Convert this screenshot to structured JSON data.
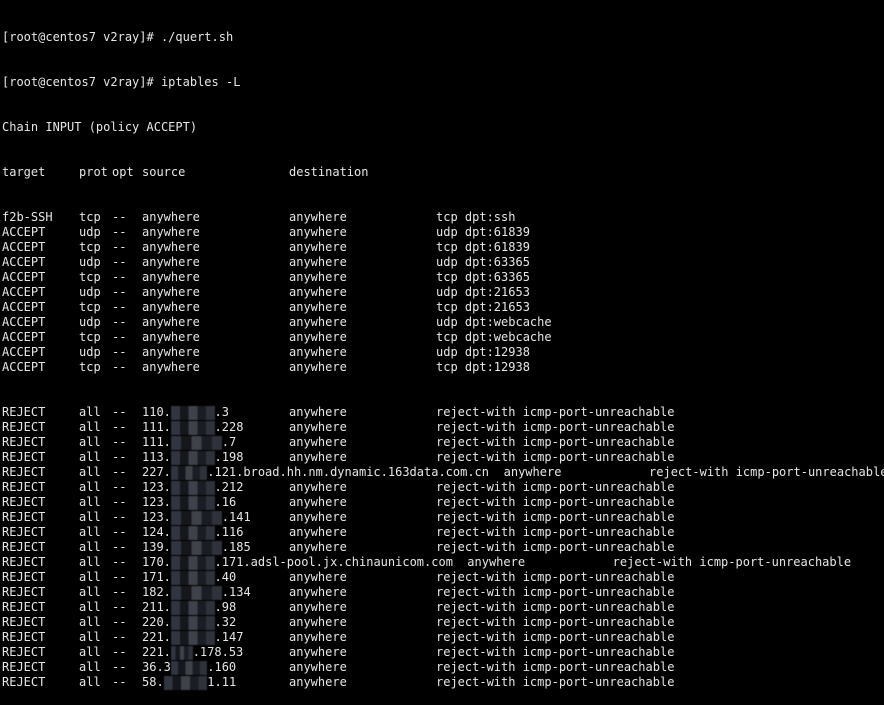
{
  "terminal": {
    "prompt_lines": [
      {
        "prompt": "[root@centos7 v2ray]# ",
        "command": "./quert.sh"
      },
      {
        "prompt": "[root@centos7 v2ray]# ",
        "command": "iptables -L"
      }
    ],
    "chain_header": "Chain INPUT (policy ACCEPT)",
    "columns": {
      "target": "target",
      "prot": "prot",
      "opt": "opt",
      "source": "source",
      "destination": "destination"
    },
    "accept_rules": [
      {
        "target": "f2b-SSH",
        "prot": "tcp",
        "opt": "--",
        "source": "anywhere",
        "destination": "anywhere",
        "extra": "tcp dpt:ssh"
      },
      {
        "target": "ACCEPT",
        "prot": "udp",
        "opt": "--",
        "source": "anywhere",
        "destination": "anywhere",
        "extra": "udp dpt:61839"
      },
      {
        "target": "ACCEPT",
        "prot": "tcp",
        "opt": "--",
        "source": "anywhere",
        "destination": "anywhere",
        "extra": "tcp dpt:61839"
      },
      {
        "target": "ACCEPT",
        "prot": "udp",
        "opt": "--",
        "source": "anywhere",
        "destination": "anywhere",
        "extra": "udp dpt:63365"
      },
      {
        "target": "ACCEPT",
        "prot": "tcp",
        "opt": "--",
        "source": "anywhere",
        "destination": "anywhere",
        "extra": "tcp dpt:63365"
      },
      {
        "target": "ACCEPT",
        "prot": "udp",
        "opt": "--",
        "source": "anywhere",
        "destination": "anywhere",
        "extra": "udp dpt:21653"
      },
      {
        "target": "ACCEPT",
        "prot": "tcp",
        "opt": "--",
        "source": "anywhere",
        "destination": "anywhere",
        "extra": "tcp dpt:21653"
      },
      {
        "target": "ACCEPT",
        "prot": "udp",
        "opt": "--",
        "source": "anywhere",
        "destination": "anywhere",
        "extra": "udp dpt:webcache"
      },
      {
        "target": "ACCEPT",
        "prot": "tcp",
        "opt": "--",
        "source": "anywhere",
        "destination": "anywhere",
        "extra": "tcp dpt:webcache"
      },
      {
        "target": "ACCEPT",
        "prot": "udp",
        "opt": "--",
        "source": "anywhere",
        "destination": "anywhere",
        "extra": "udp dpt:12938"
      },
      {
        "target": "ACCEPT",
        "prot": "tcp",
        "opt": "--",
        "source": "anywhere",
        "destination": "anywhere",
        "extra": "tcp dpt:12938"
      }
    ],
    "reject_rules": [
      {
        "target": "REJECT",
        "prot": "all",
        "opt": "--",
        "source_prefix": "110.",
        "source_suffix": ".3",
        "blur_chars": 6,
        "destination": "anywhere",
        "extra": "reject-with icmp-port-unreachable",
        "long": false
      },
      {
        "target": "REJECT",
        "prot": "all",
        "opt": "--",
        "source_prefix": "111.",
        "source_suffix": ".228",
        "blur_chars": 6,
        "destination": "anywhere",
        "extra": "reject-with icmp-port-unreachable",
        "long": false
      },
      {
        "target": "REJECT",
        "prot": "all",
        "opt": "--",
        "source_prefix": "111.",
        "source_suffix": ".7",
        "blur_chars": 7,
        "destination": "anywhere",
        "extra": "reject-with icmp-port-unreachable",
        "long": false
      },
      {
        "target": "REJECT",
        "prot": "all",
        "opt": "--",
        "source_prefix": "113.",
        "source_suffix": ".198",
        "blur_chars": 6,
        "destination": "anywhere",
        "extra": "reject-with icmp-port-unreachable",
        "long": false
      },
      {
        "target": "REJECT",
        "prot": "all",
        "opt": "--",
        "source_prefix": "227.",
        "source_suffix": ".121.broad.hh.nm.dynamic.163data.com.cn",
        "blur_chars": 5,
        "destination": "anywhere",
        "extra": "reject-with icmp-port-unreachable",
        "long": true
      },
      {
        "target": "REJECT",
        "prot": "all",
        "opt": "--",
        "source_prefix": "123.",
        "source_suffix": ".212",
        "blur_chars": 6,
        "destination": "anywhere",
        "extra": "reject-with icmp-port-unreachable",
        "long": false
      },
      {
        "target": "REJECT",
        "prot": "all",
        "opt": "--",
        "source_prefix": "123.",
        "source_suffix": ".16",
        "blur_chars": 6,
        "destination": "anywhere",
        "extra": "reject-with icmp-port-unreachable",
        "long": false
      },
      {
        "target": "REJECT",
        "prot": "all",
        "opt": "--",
        "source_prefix": "123.",
        "source_suffix": ".141",
        "blur_chars": 7,
        "destination": "anywhere",
        "extra": "reject-with icmp-port-unreachable",
        "long": false
      },
      {
        "target": "REJECT",
        "prot": "all",
        "opt": "--",
        "source_prefix": "124.",
        "source_suffix": ".116",
        "blur_chars": 6,
        "destination": "anywhere",
        "extra": "reject-with icmp-port-unreachable",
        "long": false
      },
      {
        "target": "REJECT",
        "prot": "all",
        "opt": "--",
        "source_prefix": "139.",
        "source_suffix": ".185",
        "blur_chars": 7,
        "destination": "anywhere",
        "extra": "reject-with icmp-port-unreachable",
        "long": false
      },
      {
        "target": "REJECT",
        "prot": "all",
        "opt": "--",
        "source_prefix": "170.",
        "source_suffix": ".171.adsl-pool.jx.chinaunicom.com",
        "blur_chars": 6,
        "destination": "anywhere",
        "extra": "reject-with icmp-port-unreachable",
        "long": true
      },
      {
        "target": "REJECT",
        "prot": "all",
        "opt": "--",
        "source_prefix": "171.",
        "source_suffix": ".40",
        "blur_chars": 6,
        "destination": "anywhere",
        "extra": "reject-with icmp-port-unreachable",
        "long": false
      },
      {
        "target": "REJECT",
        "prot": "all",
        "opt": "--",
        "source_prefix": "182.",
        "source_suffix": ".134",
        "blur_chars": 7,
        "destination": "anywhere",
        "extra": "reject-with icmp-port-unreachable",
        "long": false
      },
      {
        "target": "REJECT",
        "prot": "all",
        "opt": "--",
        "source_prefix": "211.",
        "source_suffix": ".98",
        "blur_chars": 6,
        "destination": "anywhere",
        "extra": "reject-with icmp-port-unreachable",
        "long": false
      },
      {
        "target": "REJECT",
        "prot": "all",
        "opt": "--",
        "source_prefix": "220.",
        "source_suffix": ".32",
        "blur_chars": 6,
        "destination": "anywhere",
        "extra": "reject-with icmp-port-unreachable",
        "long": false
      },
      {
        "target": "REJECT",
        "prot": "all",
        "opt": "--",
        "source_prefix": "221.",
        "source_suffix": ".147",
        "blur_chars": 6,
        "destination": "anywhere",
        "extra": "reject-with icmp-port-unreachable",
        "long": false
      },
      {
        "target": "REJECT",
        "prot": "all",
        "opt": "--",
        "source_prefix": "221.",
        "source_suffix": ".178.53",
        "blur_chars": 3,
        "destination": "anywhere",
        "extra": "reject-with icmp-port-unreachable",
        "long": false
      },
      {
        "target": "REJECT",
        "prot": "all",
        "opt": "--",
        "source_prefix": "36.3",
        "source_suffix": ".160",
        "blur_chars": 5,
        "destination": "anywhere",
        "extra": "reject-with icmp-port-unreachable",
        "long": false
      },
      {
        "target": "REJECT",
        "prot": "all",
        "opt": "--",
        "source_prefix": "58.",
        "source_suffix": "1.11",
        "blur_chars": 6,
        "destination": "anywhere",
        "extra": "reject-with icmp-port-unreachable",
        "long": false
      }
    ]
  }
}
